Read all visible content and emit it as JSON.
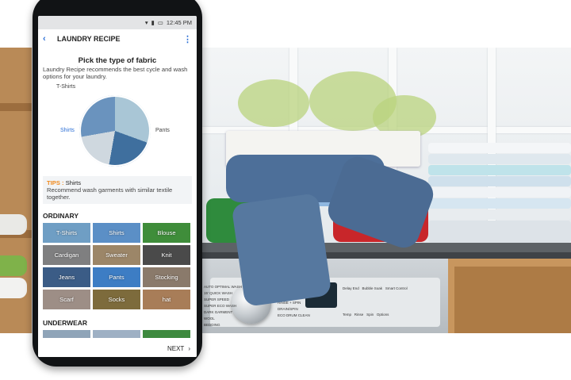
{
  "status_bar": {
    "time": "12:45 PM"
  },
  "app_bar": {
    "title": "LAUNDRY RECIPE",
    "back_icon": "chevron-left-icon",
    "more_icon": "more-vertical-icon"
  },
  "fabric_picker": {
    "heading": "Pick the type of fabric",
    "subtitle": "Laundry Recipe recommends  the best cycle and wash options for your laundry.",
    "wheel_labels": {
      "top": "T-Shirts",
      "left": "Shirts",
      "right": "Pants"
    },
    "selected": "Shirts"
  },
  "tips": {
    "prefix": "TIPS :",
    "title": "Shirts",
    "text": "Recommend wash garments with similar textile together."
  },
  "sections": {
    "ordinary": "ORDINARY",
    "underwear": "UNDERWEAR"
  },
  "ordinary_items": [
    {
      "label": "T-Shirts",
      "color": "#6f9ec4"
    },
    {
      "label": "Shirts",
      "color": "#5b8fc6"
    },
    {
      "label": "Blouse",
      "color": "#3f8d3a"
    },
    {
      "label": "Cardigan",
      "color": "#7f7f80"
    },
    {
      "label": "Sweater",
      "color": "#9c8668"
    },
    {
      "label": "Knit",
      "color": "#4a4a4a"
    },
    {
      "label": "Jeans",
      "color": "#3b5c86"
    },
    {
      "label": "Pants",
      "color": "#3d7dc4"
    },
    {
      "label": "Stocking",
      "color": "#8a7a6b"
    },
    {
      "label": "Scarf",
      "color": "#9d8e86"
    },
    {
      "label": "Socks",
      "color": "#7d6b3c"
    },
    {
      "label": "hat",
      "color": "#a87d58"
    }
  ],
  "footer": {
    "next": "NEXT",
    "next_icon": "chevron-right-icon"
  },
  "washer": {
    "left_labels": [
      "AUTO OPTIMAL WASH",
      "15' QUICK WASH",
      "SUPER SPEED",
      "SUPER ECO WASH",
      "DARK GARMENT",
      "WOOL",
      "BEDDING"
    ],
    "right_labels": [
      "SYNTHETICS",
      "DELICATES",
      "RINSE + SPIN",
      "DRAIN/SPIN",
      "ECO DRUM CLEAN"
    ],
    "grid_labels": [
      "Delay End",
      "Bubble Soak",
      "Smart Control",
      "Temp",
      "Rinse",
      "Spin",
      "Options"
    ]
  }
}
